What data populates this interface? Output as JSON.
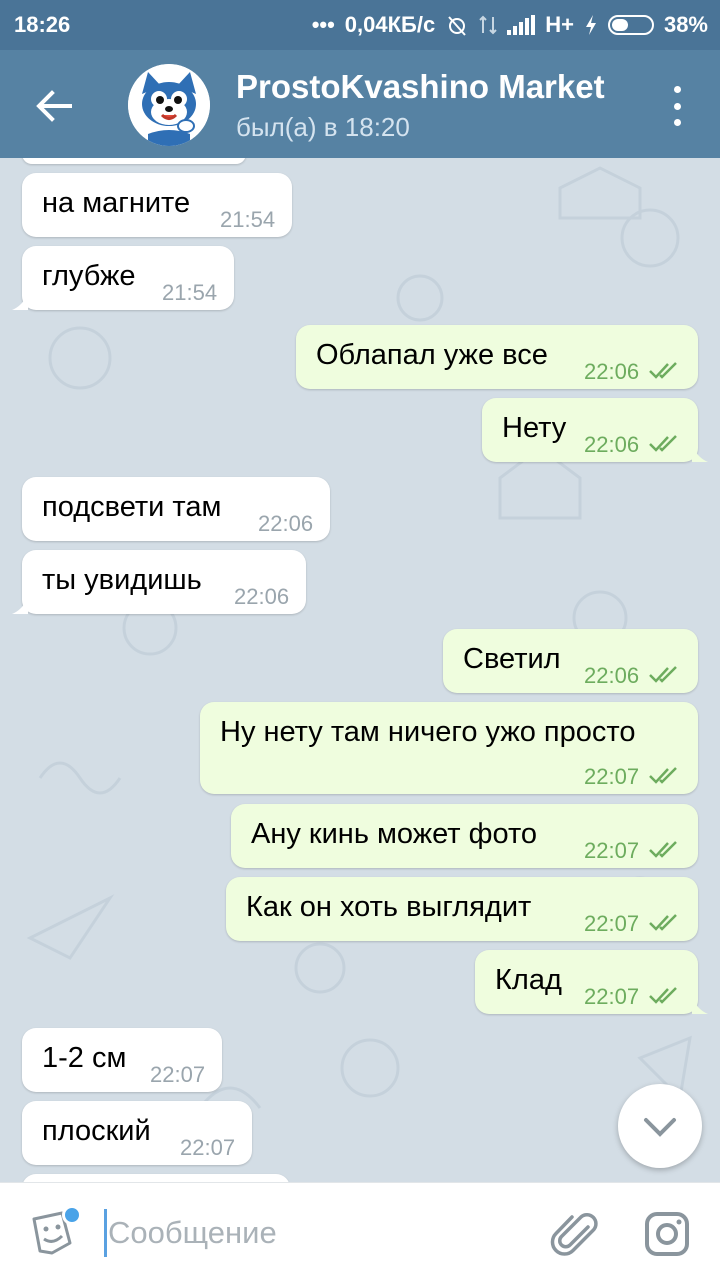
{
  "status_bar": {
    "time": "18:26",
    "dots": "•••",
    "speed": "0,04КБ/с",
    "network": "H+",
    "battery_percent": "38%"
  },
  "header": {
    "title": "ProstoKvashino Market",
    "subtitle": "был(а) в 18:20"
  },
  "messages": [
    {
      "dir": "in",
      "text": "на магните",
      "time": "21:54"
    },
    {
      "dir": "in",
      "text": "глубже",
      "time": "21:54"
    },
    {
      "dir": "out",
      "text": "Облапал уже все",
      "time": "22:06",
      "read": true
    },
    {
      "dir": "out",
      "text": "Нету",
      "time": "22:06",
      "read": true
    },
    {
      "dir": "in",
      "text": "подсвети там",
      "time": "22:06"
    },
    {
      "dir": "in",
      "text": "ты увидишь",
      "time": "22:06"
    },
    {
      "dir": "out",
      "text": "Светил",
      "time": "22:06",
      "read": true
    },
    {
      "dir": "out",
      "text": "Ну нету там ничего ужо просто",
      "time": "22:07",
      "read": true
    },
    {
      "dir": "out",
      "text": "Ану кинь может фото",
      "time": "22:07",
      "read": true
    },
    {
      "dir": "out",
      "text": "Как он хоть выглядит",
      "time": "22:07",
      "read": true
    },
    {
      "dir": "out",
      "text": "Клад",
      "time": "22:07",
      "read": true
    },
    {
      "dir": "in",
      "text": "1-2 см",
      "time": "22:07"
    },
    {
      "dir": "in",
      "text": "плоский",
      "time": "22:07"
    }
  ],
  "composer": {
    "placeholder": "Сообщение"
  },
  "icons": {
    "back": "arrow-left-icon",
    "menu": "more-vertical-icon",
    "scroll_down": "chevron-down-icon",
    "sticker": "sticker-icon",
    "attach": "paperclip-icon",
    "camera": "camera-icon",
    "read_receipt": "double-check-icon"
  },
  "colors": {
    "header": "#5682a3",
    "status_bar": "#4a7497",
    "outgoing_bubble": "#effdde",
    "incoming_bubble": "#ffffff",
    "check_color": "#6dac5e"
  }
}
